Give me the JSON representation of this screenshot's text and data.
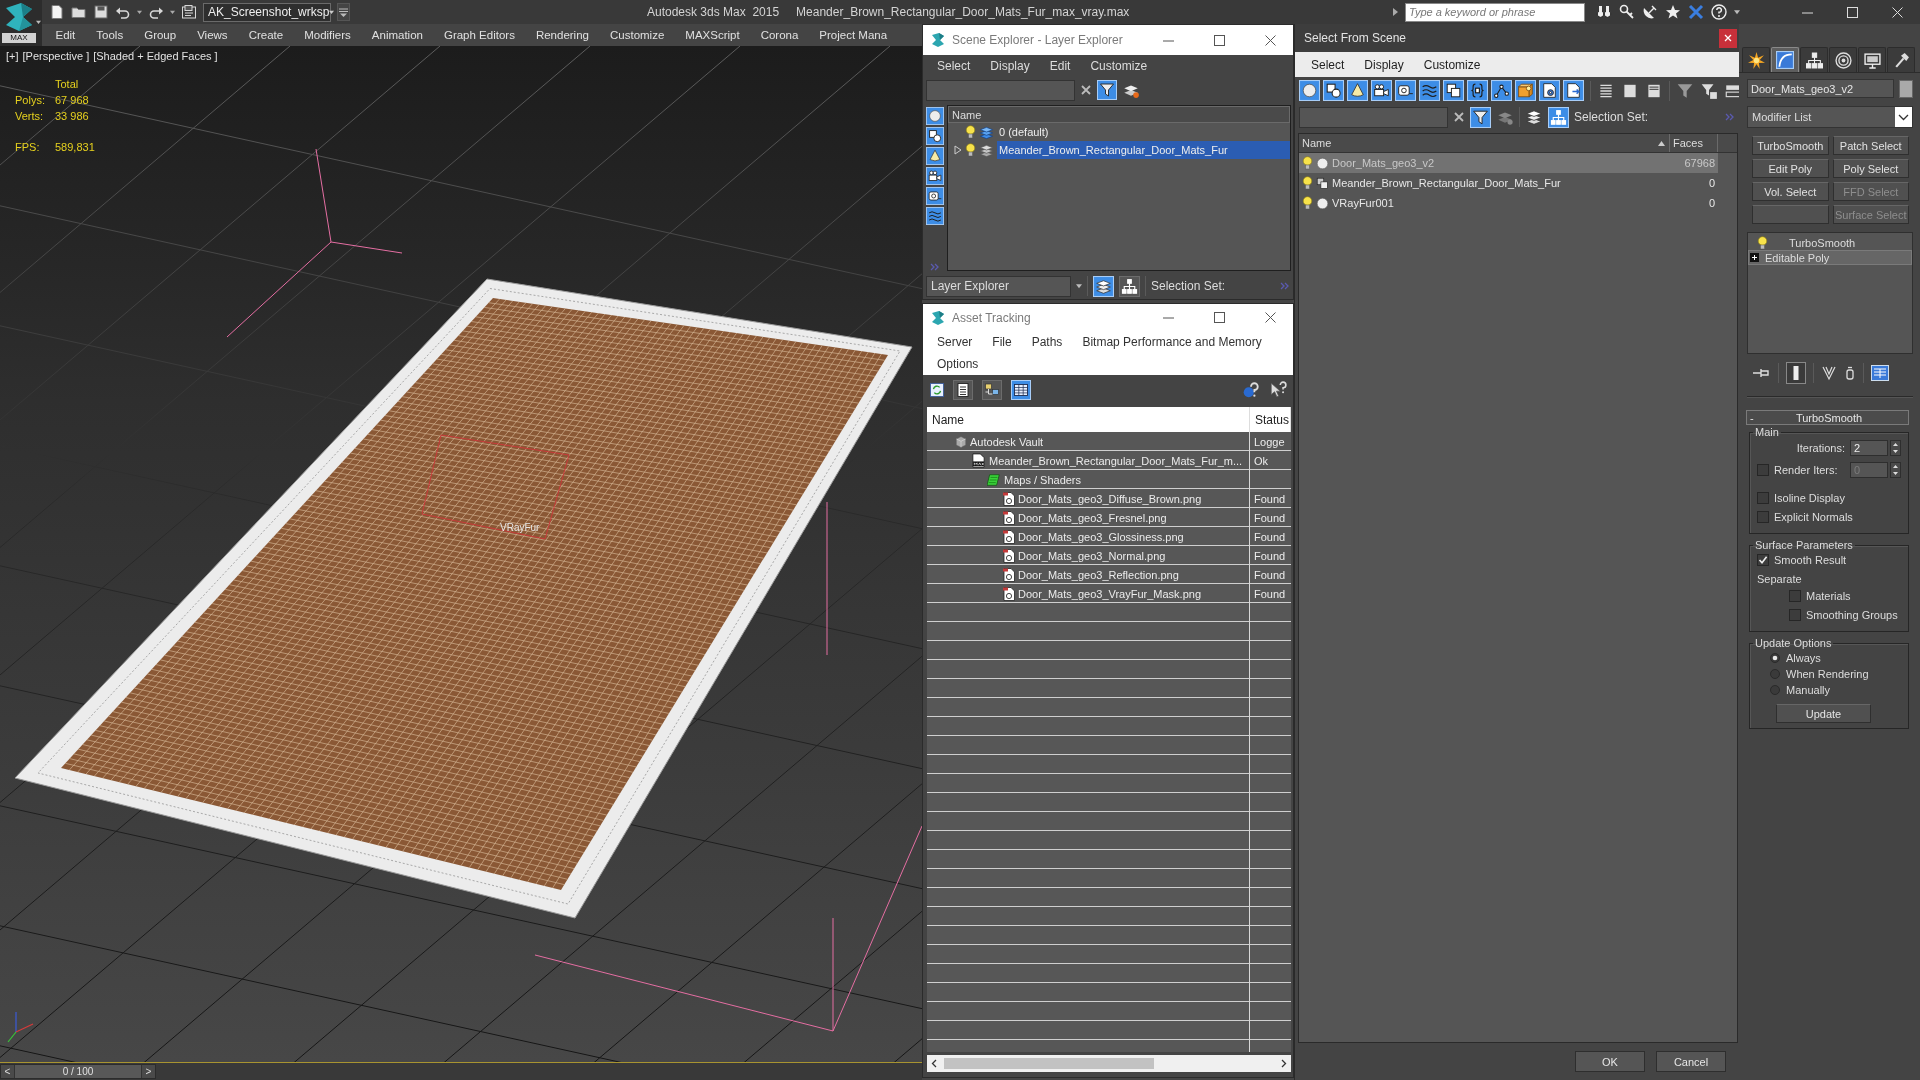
{
  "app": {
    "logo": "MAX",
    "workspace": "AK_Screenshot_wrksp",
    "title": "Autodesk 3ds Max  2015",
    "file": "Meander_Brown_Rectangular_Door_Mats_Fur_max_vray.max",
    "search": {
      "placeholder": "Type a keyword or phrase"
    }
  },
  "menu": [
    "Edit",
    "Tools",
    "Group",
    "Views",
    "Create",
    "Modifiers",
    "Animation",
    "Graph Editors",
    "Rendering",
    "Customize",
    "MAXScript",
    "Corona",
    "Project Mana"
  ],
  "viewport": {
    "labels": [
      "[+]",
      "[Perspective ]",
      "[Shaded + Edged Faces ]"
    ],
    "stats": {
      "heading": "Total",
      "rows": [
        {
          "label": "Polys:",
          "value": "67 968"
        },
        {
          "label": "Verts:",
          "value": "33 986"
        }
      ],
      "fps": {
        "label": "FPS:",
        "value": "589,831"
      }
    },
    "object_label": "VRayFur"
  },
  "time_slider": {
    "prev": "<",
    "reading": "0 / 100",
    "next": ">",
    "level": 0
  },
  "scene_explorer": {
    "title": "Scene Explorer - Layer Explorer",
    "menu": [
      "Select",
      "Display",
      "Edit",
      "Customize"
    ],
    "filter_on": true,
    "side_filters": [
      {
        "kind": "geometry",
        "on": true
      },
      {
        "kind": "shapes",
        "on": true
      },
      {
        "kind": "lights",
        "on": true
      },
      {
        "kind": "cameras",
        "on": true
      },
      {
        "kind": "helpers",
        "on": true
      },
      {
        "kind": "spacewarps",
        "on": true
      }
    ],
    "column": "Name",
    "layers": [
      {
        "name": "0 (default)",
        "expandable": false,
        "active": true,
        "selected": false
      },
      {
        "name": "Meander_Brown_Rectangular_Door_Mats_Fur",
        "expandable": true,
        "active": false,
        "selected": true
      }
    ],
    "explorer_type": "Layer Explorer",
    "view_modes": [
      {
        "kind": "layers",
        "selected": true
      },
      {
        "kind": "hierarchy",
        "selected": false
      }
    ],
    "selection_set": "Selection Set:"
  },
  "asset_tracking": {
    "title": "Asset Tracking",
    "menu": [
      "Server",
      "File",
      "Paths",
      "Bitmap Performance and Memory",
      "Options"
    ],
    "view_modes": [
      {
        "kind": "list",
        "selected": false
      },
      {
        "kind": "tree",
        "selected": false
      },
      {
        "kind": "table",
        "selected": true
      }
    ],
    "columns": [
      "Name",
      "Status"
    ],
    "rows": [
      {
        "kind": "vault",
        "name": "Autodesk Vault",
        "status": "Logge",
        "children": [
          {
            "kind": "scene",
            "name": "Meander_Brown_Rectangular_Door_Mats_Fur_m...",
            "status": "Ok",
            "children": [
              {
                "kind": "maps",
                "name": "Maps / Shaders",
                "children": [
                  {
                    "kind": "image",
                    "name": "Door_Mats_geo3_Diffuse_Brown.png",
                    "status": "Found"
                  },
                  {
                    "kind": "image",
                    "name": "Door_Mats_geo3_Fresnel.png",
                    "status": "Found"
                  },
                  {
                    "kind": "image",
                    "name": "Door_Mats_geo3_Glossiness.png",
                    "status": "Found"
                  },
                  {
                    "kind": "image",
                    "name": "Door_Mats_geo3_Normal.png",
                    "status": "Found"
                  },
                  {
                    "kind": "image",
                    "name": "Door_Mats_geo3_Reflection.png",
                    "status": "Found"
                  },
                  {
                    "kind": "image",
                    "name": "Door_Mats_geo3_VrayFur_Mask.png",
                    "status": "Found"
                  }
                ]
              }
            ]
          }
        ]
      }
    ]
  },
  "select_from_scene": {
    "title": "Select From Scene",
    "menu": [
      "Select",
      "Display",
      "Customize"
    ],
    "filters": [
      {
        "kind": "geometry",
        "on": true
      },
      {
        "kind": "shapes",
        "on": true
      },
      {
        "kind": "lights",
        "on": true
      },
      {
        "kind": "cameras",
        "on": true
      },
      {
        "kind": "helpers",
        "on": true
      },
      {
        "kind": "spacewarps",
        "on": true
      },
      {
        "kind": "groups",
        "on": true
      },
      {
        "kind": "xrefs",
        "on": true
      },
      {
        "kind": "bones",
        "on": true
      },
      {
        "kind": "containers",
        "on": true
      },
      {
        "kind": "particles",
        "on": true
      },
      {
        "kind": "frozen",
        "on": true
      }
    ],
    "filter_on": true,
    "view_modes": [
      {
        "kind": "layers",
        "selected": false
      },
      {
        "kind": "hierarchy",
        "selected": true
      }
    ],
    "selection_set": "Selection Set:",
    "columns": [
      {
        "label": "Name",
        "sorted": true
      },
      {
        "label": "Faces",
        "sorted": false
      }
    ],
    "rows": [
      {
        "kind": "geometry",
        "name": "Door_Mats_geo3_v2",
        "faces": "67968",
        "selected": true
      },
      {
        "kind": "groups",
        "name": "Meander_Brown_Rectangular_Door_Mats_Fur",
        "faces": "0",
        "selected": false
      },
      {
        "kind": "geometry",
        "name": "VRayFur001",
        "faces": "0",
        "selected": false
      }
    ],
    "buttons": [
      "OK",
      "Cancel"
    ]
  },
  "command_panel": {
    "tabs": [
      {
        "kind": "create",
        "selected": false
      },
      {
        "kind": "modify",
        "selected": true
      },
      {
        "kind": "hierarchy",
        "selected": false
      },
      {
        "kind": "motion",
        "selected": false
      },
      {
        "kind": "display",
        "selected": false
      },
      {
        "kind": "utilities",
        "selected": false
      }
    ],
    "object_name": "Door_Mats_geo3_v2",
    "modifier_list": "Modifier List",
    "modifier_buttons": [
      {
        "kind": "labelled",
        "label": "TurboSmooth",
        "disabled": false
      },
      {
        "kind": "labelled",
        "label": "Patch Select",
        "disabled": false
      },
      {
        "kind": "labelled",
        "label": "Edit Poly",
        "disabled": false
      },
      {
        "kind": "labelled",
        "label": "Poly Select",
        "disabled": false
      },
      {
        "kind": "labelled",
        "label": "Vol. Select",
        "disabled": false
      },
      {
        "kind": "labelled",
        "label": "FFD Select",
        "disabled": true
      },
      {
        "kind": "blank"
      },
      {
        "kind": "labelled",
        "label": "Surface Select",
        "disabled": true
      }
    ],
    "stack": [
      {
        "kind": "modifier",
        "name": "TurboSmooth",
        "selected": false
      },
      {
        "kind": "base",
        "name": "Editable Poly",
        "selected": true
      }
    ],
    "show_end_result": true,
    "rollout": {
      "sign": "-",
      "title": "TurboSmooth",
      "groups": [
        {
          "title": "Main",
          "controls": [
            {
              "kind": "spinner",
              "label": "Iterations:",
              "value": "2"
            },
            {
              "kind": "check_spinner",
              "label": "Render Iters:",
              "value": "0",
              "checked": false
            },
            {
              "kind": "checkbox",
              "label": "Isoline Display",
              "checked": false
            },
            {
              "kind": "checkbox",
              "label": "Explicit Normals",
              "checked": false
            }
          ]
        },
        {
          "title": "Surface Parameters",
          "controls": [
            {
              "kind": "checkbox",
              "label": "Smooth Result",
              "checked": true
            },
            {
              "kind": "heading",
              "label": "Separate",
              "children": [
                {
                  "kind": "checkbox",
                  "label": "Materials",
                  "checked": false
                },
                {
                  "kind": "checkbox",
                  "label": "Smoothing Groups",
                  "checked": false
                }
              ]
            }
          ]
        },
        {
          "title": "Update Options",
          "controls": [
            {
              "kind": "radio",
              "label": "Always",
              "selected": true
            },
            {
              "kind": "radio",
              "label": "When Rendering",
              "selected": false
            },
            {
              "kind": "radio",
              "label": "Manually",
              "selected": false
            },
            {
              "kind": "button",
              "label": "Update"
            }
          ]
        }
      ]
    }
  }
}
